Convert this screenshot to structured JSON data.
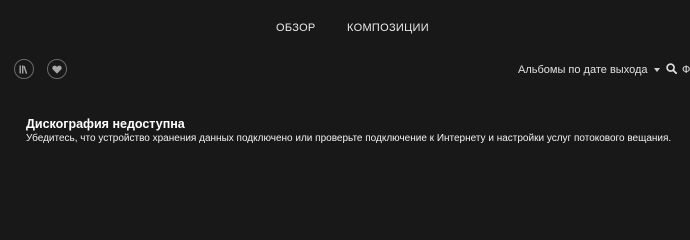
{
  "tabs": [
    {
      "label": "ОБЗОР"
    },
    {
      "label": "КОМПОЗИЦИИ"
    }
  ],
  "toolbar": {
    "library_icon": "library-icon",
    "favorite_icon": "heart-icon",
    "sort_label": "Альбомы по дате выхода",
    "search_icon": "search-icon",
    "search_label": "Ф"
  },
  "empty_state": {
    "title": "Дискография недоступна",
    "description": "Убедитесь, что устройство хранения данных подключено или проверьте подключение к Интернету и настройки услуг потокового вещания."
  },
  "colors": {
    "background": "#181818",
    "text": "#ffffff",
    "border": "#6a6a6a"
  }
}
